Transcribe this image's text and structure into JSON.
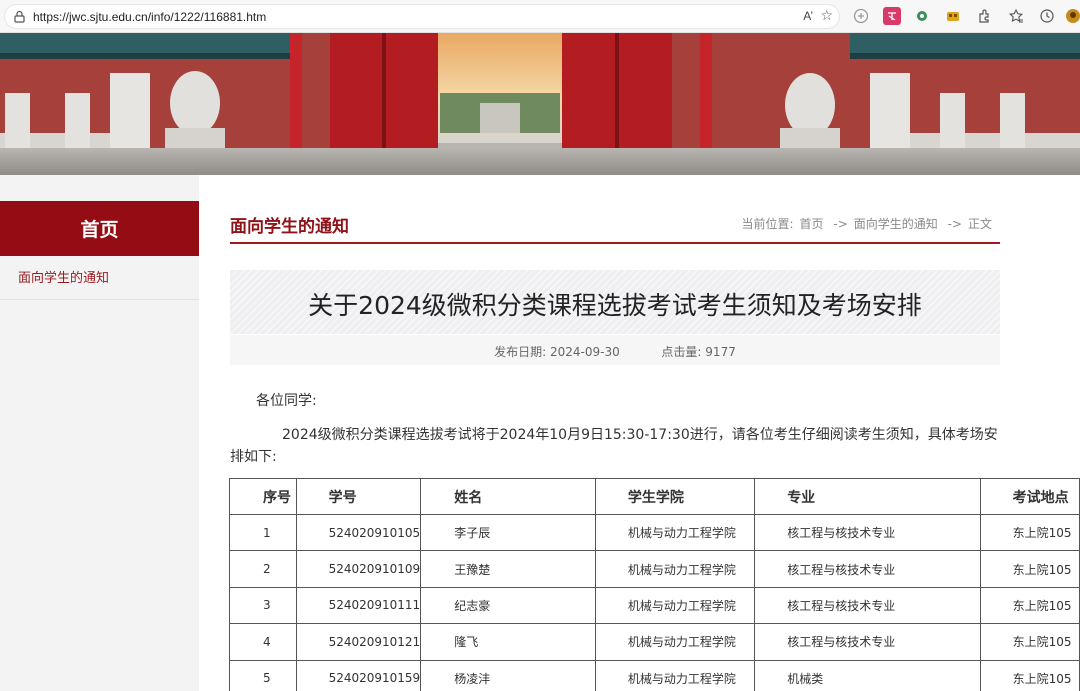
{
  "browser": {
    "url": "https://jwc.sjtu.edu.cn/info/1222/116881.htm",
    "read_aloud_label": "A’",
    "star": "☆"
  },
  "sidebar": {
    "home_label": "首页",
    "items": [
      {
        "label": "面向学生的通知"
      }
    ]
  },
  "section": {
    "title": "面向学生的通知",
    "breadcrumb": {
      "prefix": "当前位置:",
      "home": "首页",
      "sep1": "->",
      "category": "面向学生的通知",
      "sep2": "->",
      "current": "正文"
    }
  },
  "article": {
    "title": "关于2024级微积分类课程选拔考试考生须知及考场安排",
    "date_label": "发布日期:",
    "date": "2024-09-30",
    "clicks_label": "点击量:",
    "clicks": "9177",
    "greeting": "各位同学:",
    "intro": "2024级微积分类课程选拔考试将于2024年10月9日15:30-17:30进行，请各位考生仔细阅读考生须知，具体考场安排如下:"
  },
  "table": {
    "headers": [
      "序号",
      "学号",
      "姓名",
      "学生学院",
      "专业",
      "考试地点"
    ],
    "rows": [
      [
        "1",
        "524020910105",
        "李子辰",
        "机械与动力工程学院",
        "核工程与核技术专业",
        "东上院105"
      ],
      [
        "2",
        "524020910109",
        "王豫楚",
        "机械与动力工程学院",
        "核工程与核技术专业",
        "东上院105"
      ],
      [
        "3",
        "524020910111",
        "纪志豪",
        "机械与动力工程学院",
        "核工程与核技术专业",
        "东上院105"
      ],
      [
        "4",
        "524020910121",
        "隆飞",
        "机械与动力工程学院",
        "核工程与核技术专业",
        "东上院105"
      ],
      [
        "5",
        "524020910159",
        "杨凌沣",
        "机械与动力工程学院",
        "机械类",
        "东上院105"
      ]
    ]
  },
  "colors": {
    "brand_red": "#950d14",
    "accent_text": "#8f1218"
  }
}
